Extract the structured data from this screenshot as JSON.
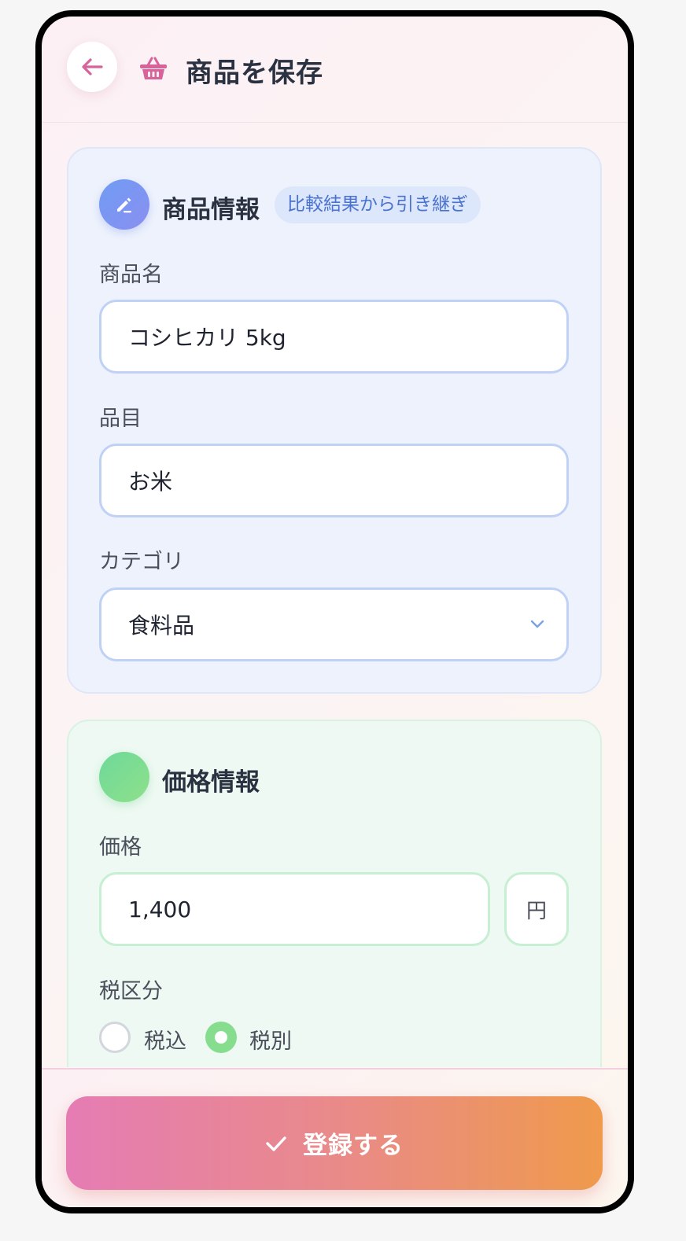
{
  "header": {
    "title": "商品を保存"
  },
  "product_card": {
    "title": "商品情報",
    "badge": "比較結果から引き継ぎ",
    "name_label": "商品名",
    "name_value": "コシヒカリ 5kg",
    "item_label": "品目",
    "item_value": "お米",
    "category_label": "カテゴリ",
    "category_value": "食料品"
  },
  "price_card": {
    "title": "価格情報",
    "price_label": "価格",
    "price_value": "1,400",
    "currency": "円",
    "tax_label": "税区分",
    "tax_options": [
      "税込",
      "税別"
    ],
    "tax_selected": "税別"
  },
  "footer": {
    "submit_label": "登録する"
  },
  "icons": {
    "back": "arrow-left-icon",
    "basket": "basket-icon",
    "edit": "pencil-icon",
    "chevron": "chevron-down-icon",
    "check": "check-icon"
  },
  "colors": {
    "accent_pink": "#e57cb4",
    "accent_orange": "#ef9a4c",
    "blue_badge_text": "#4a72cf",
    "green_radio": "#85dd8d"
  }
}
